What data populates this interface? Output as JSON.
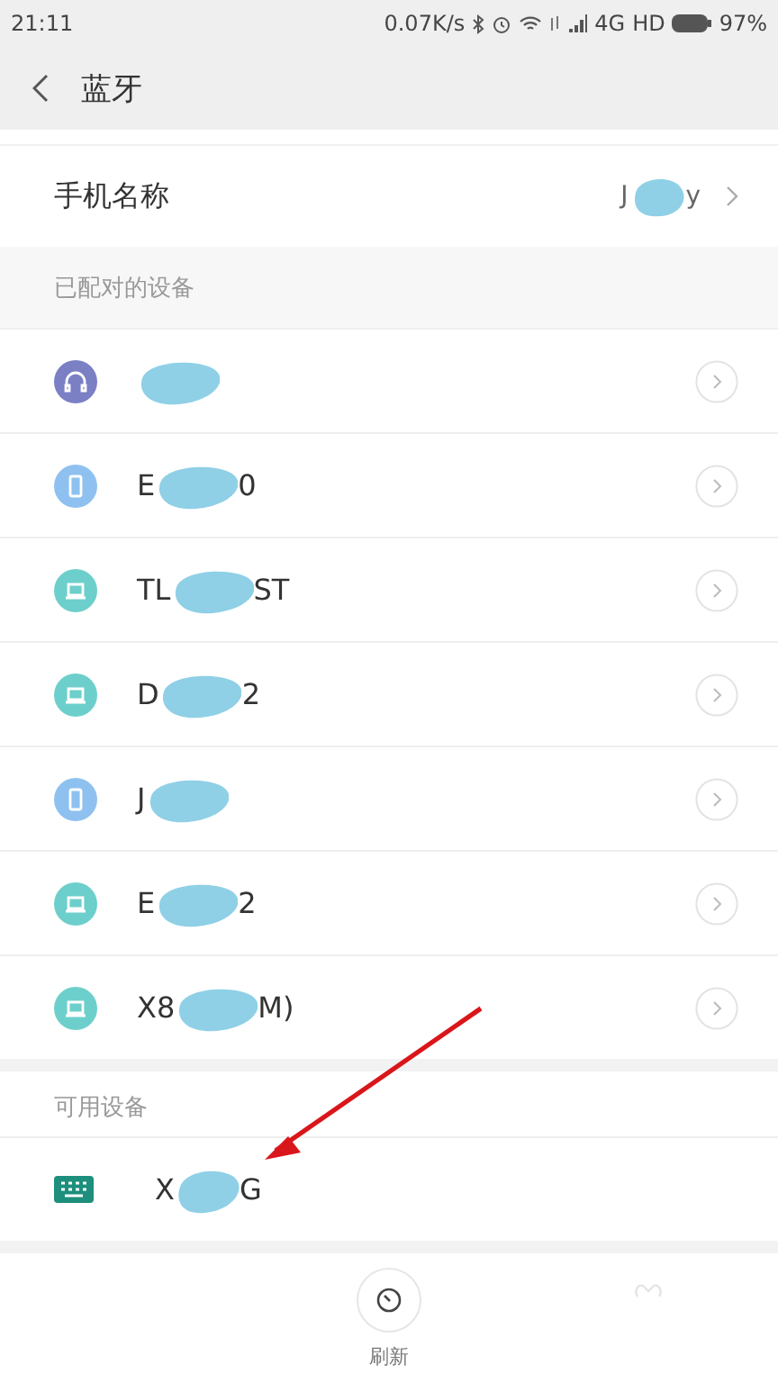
{
  "status_bar": {
    "time": "21:11",
    "speed": "0.07K/s",
    "network": "4G",
    "hd": "HD",
    "battery": "97%"
  },
  "header": {
    "title": "蓝牙"
  },
  "phone_name": {
    "label": "手机名称",
    "value_head": "J",
    "value_tail": "y",
    "redacted": true
  },
  "paired": {
    "title": "已配对的设备",
    "devices": [
      {
        "kind": "headset",
        "color": "#7b7fc4",
        "redacted": true
      },
      {
        "kind": "phone",
        "color": "#8ec1f0",
        "head": "E",
        "tail": "0",
        "redacted": true
      },
      {
        "kind": "laptop",
        "color": "#6dcfcb",
        "head": "TL",
        "tail": "ST",
        "redacted": true
      },
      {
        "kind": "laptop",
        "color": "#6dcfcb",
        "head": "D",
        "tail": "2",
        "redacted": true
      },
      {
        "kind": "phone",
        "color": "#8ec1f0",
        "head": "J",
        "redacted": true
      },
      {
        "kind": "laptop",
        "color": "#6dcfcb",
        "head": "E",
        "tail": "2",
        "redacted": true
      },
      {
        "kind": "laptop",
        "color": "#6dcfcb",
        "head": "X8",
        "tail": "M)",
        "redacted": true
      }
    ]
  },
  "available": {
    "title": "可用设备",
    "devices": [
      {
        "kind": "keyboard",
        "color": "#1d8f7c",
        "head": "X",
        "tail": "G",
        "redacted": true
      }
    ]
  },
  "annotation": {
    "kind": "arrow"
  },
  "bottom_bar": {
    "refresh": "刷新"
  }
}
